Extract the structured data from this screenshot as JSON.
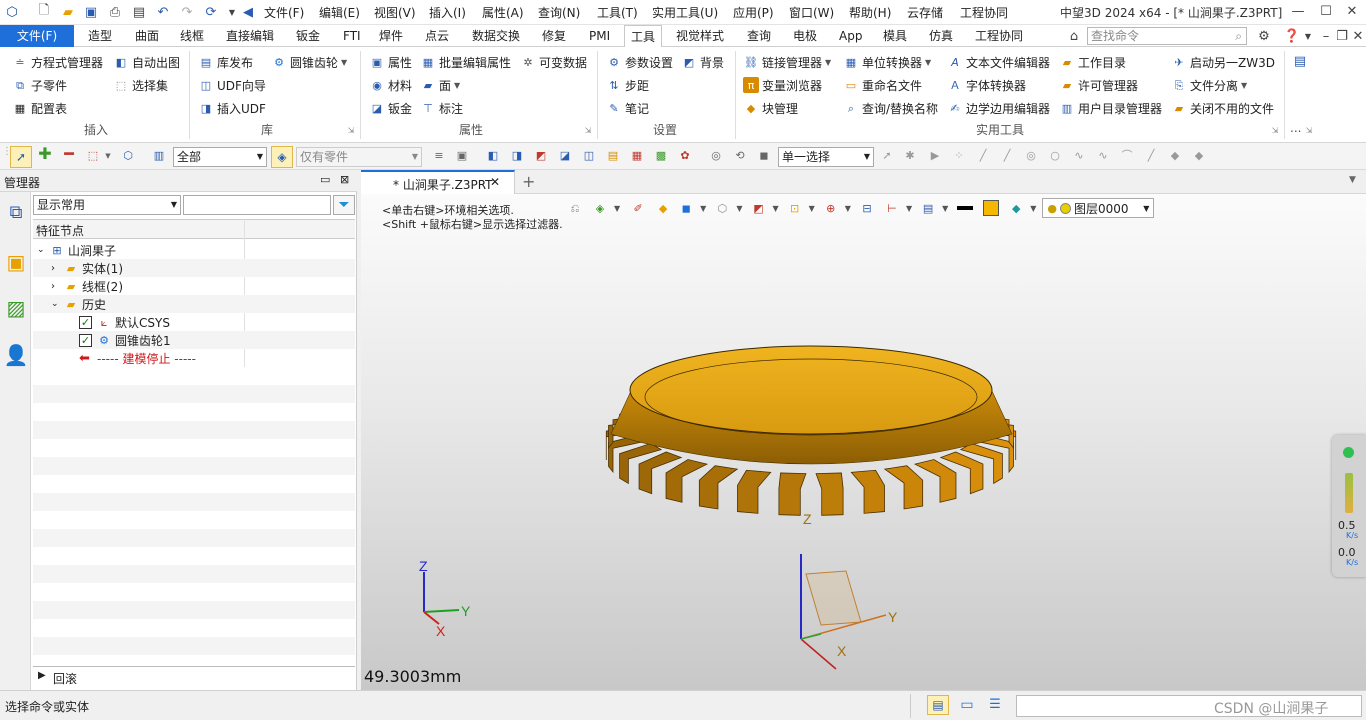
{
  "window": {
    "title": "中望3D 2024 x64 - [* 山涧果子.Z3PRT]",
    "menus": [
      "文件(F)",
      "编辑(E)",
      "视图(V)",
      "插入(I)",
      "属性(A)",
      "查询(N)",
      "工具(T)",
      "实用工具(U)",
      "应用(P)",
      "窗口(W)",
      "帮助(H)",
      "云存储",
      "工程协同"
    ]
  },
  "tabs": [
    "文件(F)",
    "造型",
    "曲面",
    "线框",
    "直接编辑",
    "钣金",
    "FTI",
    "焊件",
    "点云",
    "数据交换",
    "修复",
    "PMI",
    "工具",
    "视觉样式",
    "查询",
    "电极",
    "App",
    "模具",
    "仿真",
    "工程协同"
  ],
  "search": {
    "placeholder": "查找命令"
  },
  "ribbon": {
    "insert": {
      "label": "插入",
      "items": [
        "方程式管理器",
        "子零件",
        "配置表",
        "自动出图",
        "选择集"
      ]
    },
    "library": {
      "label": "库",
      "items": [
        "库发布",
        "UDF向导",
        "插入UDF",
        "圆锥齿轮"
      ]
    },
    "attributes": {
      "label": "属性",
      "items": [
        "属性",
        "材料",
        "钣金",
        "批量编辑属性",
        "面",
        "标注",
        "可变数据"
      ]
    },
    "settings": {
      "label": "设置",
      "items": [
        "参数设置",
        "步距",
        "笔记",
        "背景"
      ]
    },
    "utilities": {
      "label": "实用工具",
      "items": [
        "链接管理器",
        "变量浏览器",
        "块管理",
        "单位转换器",
        "重命名文件",
        "查询/替换名称",
        "文本文件编辑器",
        "字体转换器",
        "边学边用编辑器",
        "工作目录",
        "许可管理器",
        "用户目录管理器",
        "启动另一ZW3D",
        "文件分离",
        "关闭不用的文件"
      ]
    },
    "more": "..."
  },
  "filterbar": {
    "filter_value": "全部",
    "part_filter": "仅有零件",
    "select_mode": "单一选择"
  },
  "manager": {
    "title": "管理器",
    "display": "显示常用",
    "column_header": "特征节点",
    "tree": {
      "root": "山涧果子",
      "solid": "实体(1)",
      "wireframe": "线框(2)",
      "history": "历史",
      "csys": "默认CSYS",
      "gear": "圆锥齿轮1",
      "stop": "----- 建模停止 -----"
    },
    "rollback": "回滚"
  },
  "document": {
    "tab": "* 山涧果子.Z3PRT"
  },
  "viewport": {
    "hint1": "<单击右键>环境相关选项.",
    "hint2": "<Shift +鼠标右键>显示选择过滤器.",
    "layer": "图层0000",
    "dimension": "49.3003mm",
    "axis_x": "X",
    "axis_y": "Y",
    "axis_z": "Z",
    "net_up": "0.5",
    "net_up_unit": "K/s",
    "net_down": "0.0",
    "net_down_unit": "K/s"
  },
  "status": {
    "text": "选择命令或实体",
    "watermark": "CSDN @山涧果子"
  },
  "colors": {
    "accent": "#1e6fd9",
    "gear": "#e1a112",
    "gear_dark": "#9c6a05"
  }
}
